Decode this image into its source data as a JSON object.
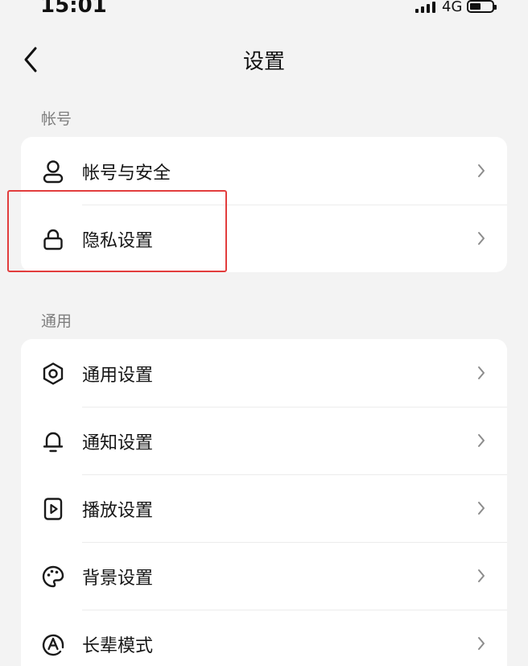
{
  "status_bar": {
    "time": "15:01",
    "network": "4G",
    "battery_level": 0.5
  },
  "nav": {
    "title": "设置",
    "back_icon": "chevron-left-icon"
  },
  "sections": [
    {
      "header": "帐号",
      "items": [
        {
          "label": "帐号与安全",
          "icon": "user-icon"
        },
        {
          "label": "隐私设置",
          "icon": "lock-icon"
        }
      ]
    },
    {
      "header": "通用",
      "items": [
        {
          "label": "通用设置",
          "icon": "gear-icon"
        },
        {
          "label": "通知设置",
          "icon": "bell-icon"
        },
        {
          "label": "播放设置",
          "icon": "play-icon"
        },
        {
          "label": "背景设置",
          "icon": "palette-icon"
        },
        {
          "label": "长辈模式",
          "icon": "elder-mode-icon"
        }
      ]
    }
  ],
  "colors": {
    "background": "#f3f3f3",
    "card": "#ffffff",
    "highlight": "#e23d3d"
  }
}
